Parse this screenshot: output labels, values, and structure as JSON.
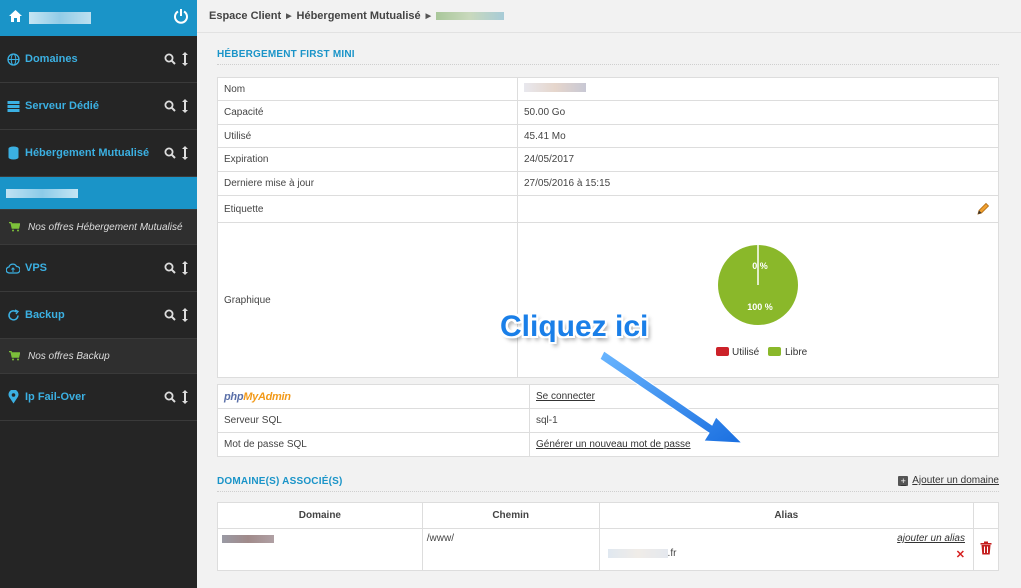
{
  "sidebar": {
    "items": [
      {
        "label": "Domaines"
      },
      {
        "label": "Serveur Dédié"
      },
      {
        "label": "Hébergement Mutualisé"
      },
      {
        "label": "VPS"
      },
      {
        "label": "Backup"
      },
      {
        "label": "Ip Fail-Over"
      }
    ],
    "sub_hebergement": "Nos offres Hébergement Mutualisé",
    "sub_backup": "Nos offres Backup"
  },
  "breadcrumb": {
    "root": "Espace Client",
    "section": "Hébergement Mutualisé"
  },
  "hosting": {
    "title": "HÉBERGEMENT FIRST MINI",
    "rows": [
      {
        "key": "Nom",
        "value": ""
      },
      {
        "key": "Capacité",
        "value": "50.00 Go"
      },
      {
        "key": "Utilisé",
        "value": "45.41 Mo"
      },
      {
        "key": "Expiration",
        "value": "24/05/2017"
      },
      {
        "key": "Derniere mise à jour",
        "value": "27/05/2016 à 15:15"
      },
      {
        "key": "Etiquette",
        "value": ""
      },
      {
        "key": "Graphique",
        "value": ""
      }
    ],
    "chart": {
      "used_label": "0 %",
      "free_label": "100 %",
      "used_fraction": 0.0,
      "legend_used": "Utilisé",
      "legend_free": "Libre",
      "color_used": "#cc2229",
      "color_free": "#8ab82a"
    }
  },
  "sql": {
    "phpmyadmin_p": "php",
    "phpmyadmin_m": "MyAdmin",
    "connect_link": "Se connecter",
    "server_label": "Serveur SQL",
    "server_value": "sql-1",
    "password_label": "Mot de passe SQL",
    "password_link": "Générer un nouveau mot de passe"
  },
  "callout": "Cliquez ici",
  "domains": {
    "title": "DOMAINE(S) ASSOCIÉ(S)",
    "add_label": "Ajouter un domaine",
    "columns": [
      "Domaine",
      "Chemin",
      "Alias"
    ],
    "row": {
      "path": "/www/",
      "add_alias": "ajouter un alias",
      "alias_suffix": ".fr"
    }
  }
}
